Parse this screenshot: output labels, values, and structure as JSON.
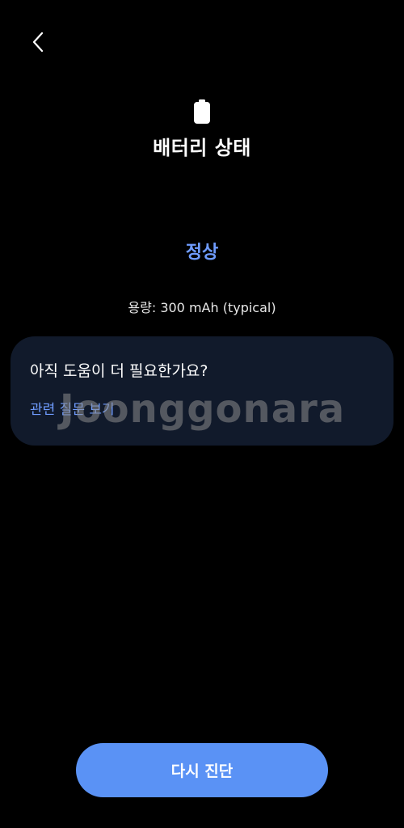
{
  "header": {
    "back_icon": "chevron-left-icon",
    "status_icon": "battery-icon",
    "title": "배터리 상태"
  },
  "battery": {
    "status": "정상",
    "capacity": "용량: 300 mAh (typical)"
  },
  "help_card": {
    "question": "아직 도움이 더 필요한가요?",
    "link": "관련 질문 보기"
  },
  "watermark": "Joonggonara",
  "actions": {
    "rediagnose_label": "다시 진단"
  },
  "colors": {
    "background": "#000000",
    "accent": "#6f9cff",
    "card": "#111a2b",
    "button": "#5a92f5"
  }
}
